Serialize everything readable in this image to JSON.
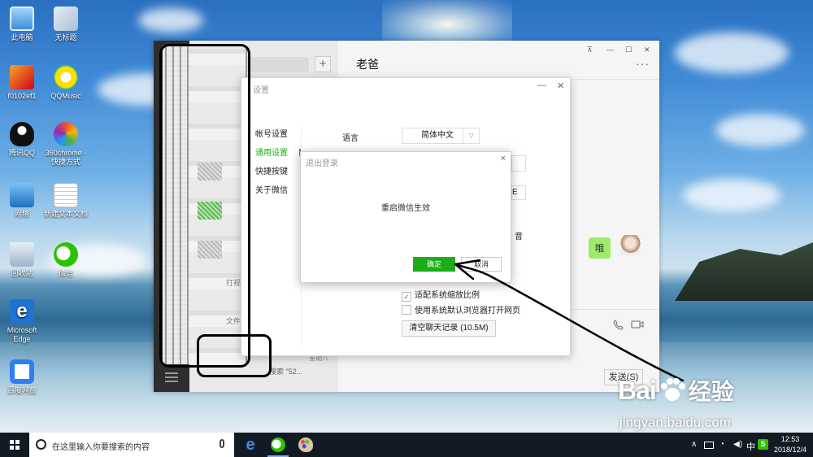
{
  "desktop": {
    "icons": [
      {
        "label": "此电脑"
      },
      {
        "label": "无标题"
      },
      {
        "label": "f0102ef1"
      },
      {
        "label": "QQMusic"
      },
      {
        "label": "腾讯QQ"
      },
      {
        "label": "360chrome - 快捷方式"
      },
      {
        "label": "网络"
      },
      {
        "label": "新建文本文档"
      },
      {
        "label": "回收站"
      },
      {
        "label": "微信"
      },
      {
        "label": "Microsoft Edge"
      },
      {
        "label": "百度网盘"
      }
    ]
  },
  "wechat": {
    "chat_title": "老爸",
    "more": "···",
    "pin": "⊼",
    "minimize": "—",
    "maximize": "☐",
    "close": "✕",
    "plus": "+",
    "message": "哦",
    "send_label": "发送(S)",
    "list_bottom_text": "搜索 \"52...",
    "list_bottom_text2": "星期八",
    "blurred_words": [
      "打视",
      "文件"
    ]
  },
  "settings": {
    "title": "设置",
    "nav": [
      "帐号设置",
      "通用设置",
      "快捷按键",
      "关于微信"
    ],
    "language_label": "语言",
    "language_value": "简体中文",
    "ghost_text_a": "音",
    "ghost_text_b": "E",
    "checkbox_scaling": "适配系统缩放比例",
    "checkbox_browser": "使用系统默认浏览器打开网页",
    "clear_button": "清空聊天记录 (10.5M)"
  },
  "logout_dialog": {
    "title": "退出登录",
    "message": "重启微信生效",
    "ok": "确定",
    "cancel": "取消"
  },
  "watermark": {
    "brand": "Bai",
    "brand_tail": "经验",
    "url": "jingyan.baidu.com"
  },
  "taskbar": {
    "search_placeholder": "在这里输入你要搜索的内容",
    "time": "12:53",
    "date": "2018/12/4",
    "tray_ime": "S"
  }
}
